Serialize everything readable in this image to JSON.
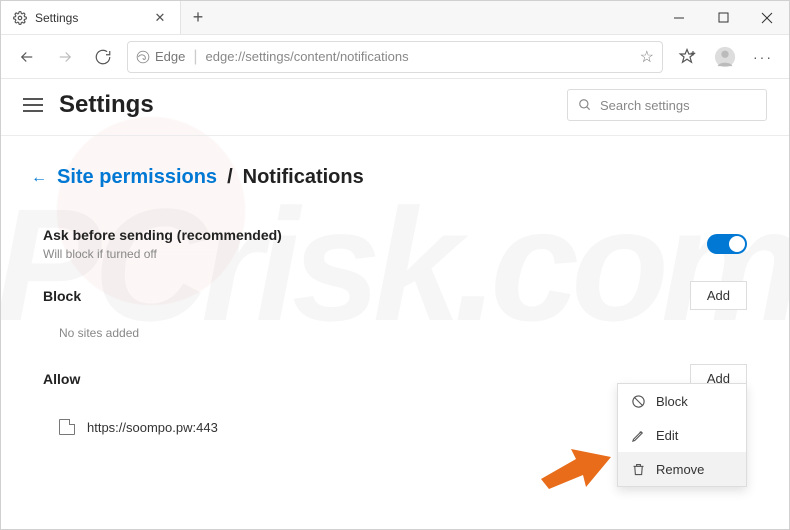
{
  "window": {
    "tab_title": "Settings"
  },
  "toolbar": {
    "edge_label": "Edge",
    "url": "edge://settings/content/notifications"
  },
  "header": {
    "title": "Settings",
    "search_placeholder": "Search settings"
  },
  "breadcrumb": {
    "back_link": "Site permissions",
    "separator": "/",
    "current": "Notifications"
  },
  "ask": {
    "label": "Ask before sending (recommended)",
    "sub": "Will block if turned off",
    "enabled": true
  },
  "block": {
    "label": "Block",
    "add": "Add",
    "empty": "No sites added"
  },
  "allow": {
    "label": "Allow",
    "add": "Add",
    "items": [
      {
        "url": "https://soompo.pw:443"
      }
    ]
  },
  "menu": {
    "block": "Block",
    "edit": "Edit",
    "remove": "Remove"
  }
}
